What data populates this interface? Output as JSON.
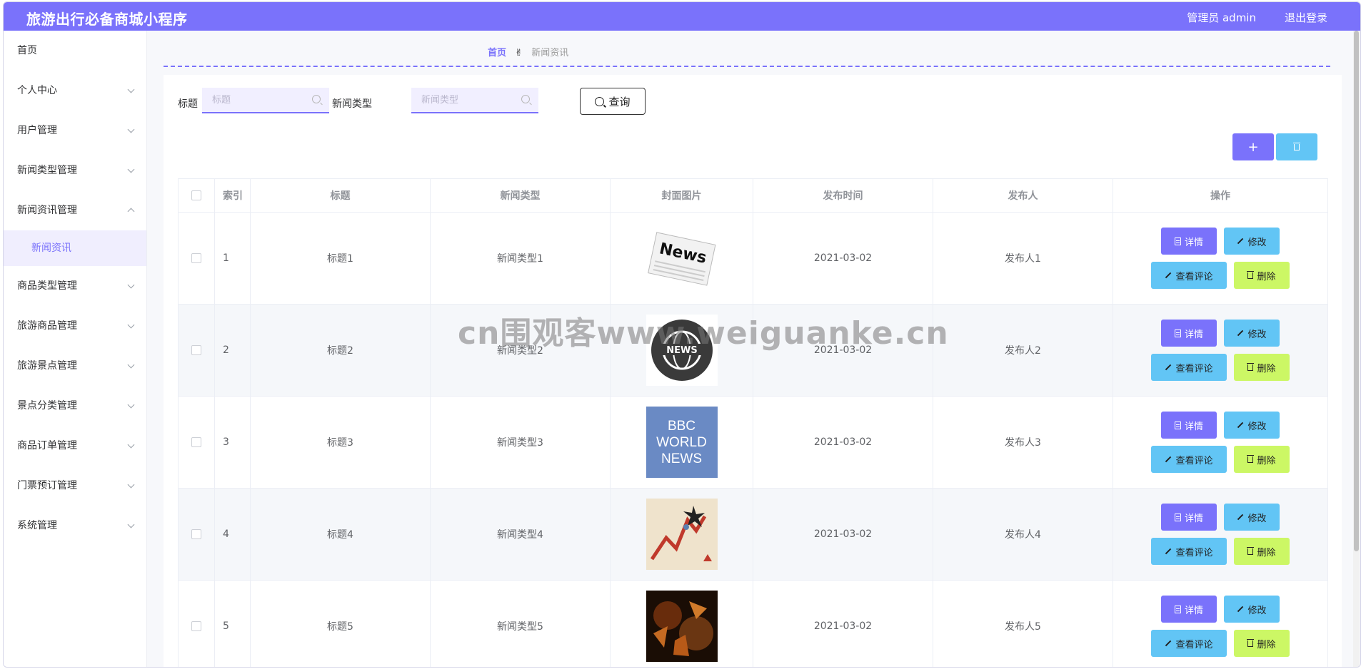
{
  "header": {
    "app_title": "旅游出行必备商城小程序",
    "admin_label": "管理员 admin",
    "logout": "退出登录"
  },
  "sidebar": {
    "items": [
      {
        "label": "首页",
        "expandable": false
      },
      {
        "label": "个人中心",
        "expandable": true
      },
      {
        "label": "用户管理",
        "expandable": true
      },
      {
        "label": "新闻类型管理",
        "expandable": true
      },
      {
        "label": "新闻资讯管理",
        "expandable": true,
        "expanded": true,
        "children": [
          "新闻资讯"
        ]
      },
      {
        "label": "商品类型管理",
        "expandable": true
      },
      {
        "label": "旅游商品管理",
        "expandable": true
      },
      {
        "label": "旅游景点管理",
        "expandable": true
      },
      {
        "label": "景点分类管理",
        "expandable": true
      },
      {
        "label": "商品订单管理",
        "expandable": true
      },
      {
        "label": "门票预订管理",
        "expandable": true
      },
      {
        "label": "系统管理",
        "expandable": true
      }
    ]
  },
  "breadcrumb": {
    "home": "首页",
    "separator": "✌",
    "current": "新闻资讯"
  },
  "search": {
    "title_label": "标题",
    "title_placeholder": "标题",
    "type_label": "新闻类型",
    "type_placeholder": "新闻类型",
    "query_button": "查询"
  },
  "toolbar": {
    "add_symbol": "+"
  },
  "table": {
    "columns": [
      "索引",
      "标题",
      "新闻类型",
      "封面图片",
      "发布时间",
      "发布人",
      "操作"
    ],
    "rows": [
      {
        "index": "1",
        "title": "标题1",
        "type": "新闻类型1",
        "cover_text": "News",
        "date": "2021-03-02",
        "publisher": "发布人1"
      },
      {
        "index": "2",
        "title": "标题2",
        "type": "新闻类型2",
        "cover_text": "NEWS",
        "date": "2021-03-02",
        "publisher": "发布人2"
      },
      {
        "index": "3",
        "title": "标题3",
        "type": "新闻类型3",
        "cover_text": "BBC WORLD NEWS",
        "date": "2021-03-02",
        "publisher": "发布人3"
      },
      {
        "index": "4",
        "title": "标题4",
        "type": "新闻类型4",
        "cover_text": "",
        "date": "2021-03-02",
        "publisher": "发布人4"
      },
      {
        "index": "5",
        "title": "标题5",
        "type": "新闻类型5",
        "cover_text": "",
        "date": "2021-03-02",
        "publisher": "发布人5"
      }
    ],
    "actions": {
      "detail": "详情",
      "edit": "修改",
      "comment": "查看评论",
      "delete": "删除"
    }
  },
  "watermark": "cn围观客www.weiguanke.cn",
  "colors": {
    "accent": "#7a72fb",
    "cyan": "#62c5f5",
    "lime": "#ccf765"
  }
}
